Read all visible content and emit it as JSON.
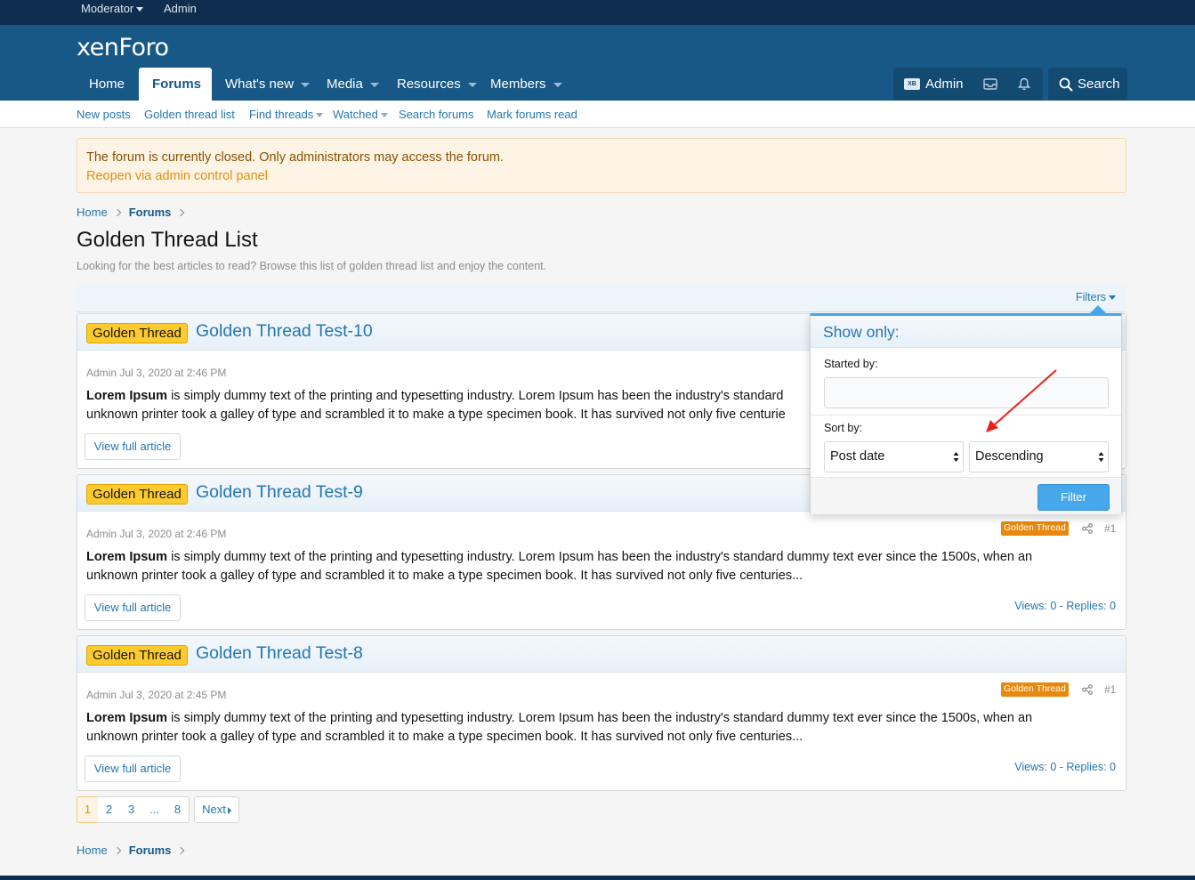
{
  "staffbar": {
    "moderator": "Moderator",
    "admin": "Admin"
  },
  "header": {
    "logo": "xenForo"
  },
  "nav": {
    "home": "Home",
    "forums": "Forums",
    "whats_new": "What's new",
    "media": "Media",
    "resources": "Resources",
    "members": "Members",
    "account": "Admin",
    "search": "Search"
  },
  "subnav": {
    "new_posts": "New posts",
    "golden_list": "Golden thread list",
    "find_threads": "Find threads",
    "watched": "Watched",
    "search_forums": "Search forums",
    "mark_read": "Mark forums read"
  },
  "notice": {
    "text": "The forum is currently closed. Only administrators may access the forum.",
    "link": "Reopen via admin control panel"
  },
  "breadcrumb": {
    "home": "Home",
    "forums": "Forums"
  },
  "page": {
    "title": "Golden Thread List",
    "description": "Looking for the best articles to read? Browse this list of golden thread list and enjoy the content."
  },
  "filters_label": "Filters",
  "popup": {
    "title": "Show only:",
    "started_by": "Started by:",
    "started_by_value": "",
    "sort_by": "Sort by:",
    "sort_field": "Post date",
    "sort_order": "Descending",
    "filter_button": "Filter"
  },
  "threads": [
    {
      "badge": "Golden Thread",
      "title": "Golden Thread Test-10",
      "meta": "Admin Jul 3, 2020 at 2:46 PM",
      "lead": "Lorem Ipsum",
      "line1": " is simply dummy text of the printing and typesetting industry. Lorem Ipsum has been the industry's standard",
      "line2": "unknown printer took a galley of type and scrambled it to make a type specimen book. It has survived not only five centurie",
      "button": "View full article"
    },
    {
      "badge": "Golden Thread",
      "title": "Golden Thread Test-9",
      "meta": "Admin Jul 3, 2020 at 2:46 PM",
      "mini_badge": "Golden Thread",
      "post_num": "#1",
      "lead": "Lorem Ipsum",
      "line1": " is simply dummy text of the printing and typesetting industry. Lorem Ipsum has been the industry's standard dummy text ever since the 1500s, when an",
      "line2": "unknown printer took a galley of type and scrambled it to make a type specimen book. It has survived not only five centuries...",
      "button": "View full article",
      "stats": "Views: 0 - Replies: 0"
    },
    {
      "badge": "Golden Thread",
      "title": "Golden Thread Test-8",
      "meta": "Admin Jul 3, 2020 at 2:45 PM",
      "mini_badge": "Golden Thread",
      "post_num": "#1",
      "lead": "Lorem Ipsum",
      "line1": " is simply dummy text of the printing and typesetting industry. Lorem Ipsum has been the industry's standard dummy text ever since the 1500s, when an",
      "line2": "unknown printer took a galley of type and scrambled it to make a type specimen book. It has survived not only five centuries...",
      "button": "View full article",
      "stats": "Views: 0 - Replies: 0"
    }
  ],
  "pagination": {
    "pages": [
      "1",
      "2",
      "3",
      "...",
      "8"
    ],
    "current": "1",
    "next": "Next"
  },
  "colors": {
    "header": "#185886",
    "staffbar": "#0f2d4e",
    "link": "#2577b1",
    "golden": "#fecb2f",
    "annotation_arrow": "#e8221b"
  }
}
